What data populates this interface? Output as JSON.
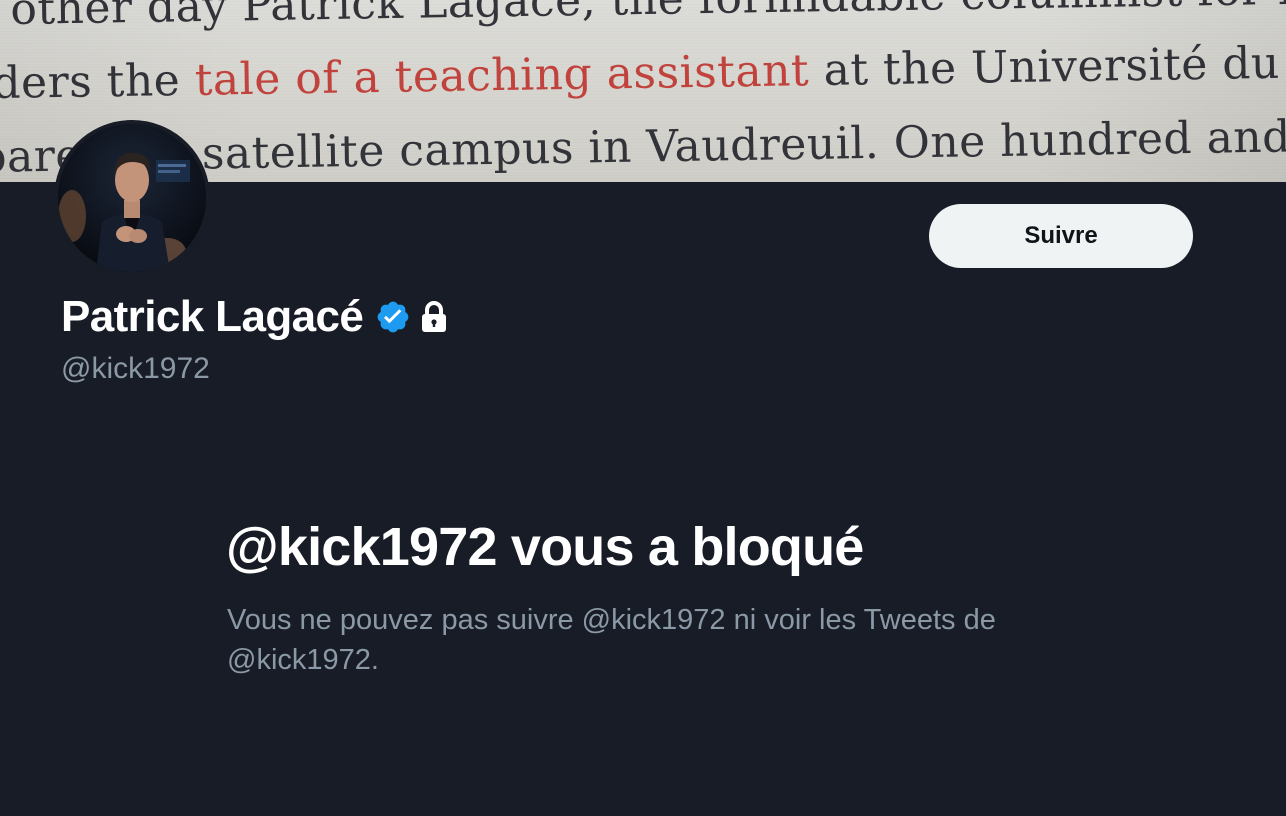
{
  "banner": {
    "line1": "other day Patrick Lagace, the formidable columnist for Mont",
    "line2_start": "ders the ",
    "line2_link": "tale of a teaching assistant",
    "line2_end": " at the Université du Québec",
    "line3": "pare  as a satellite campus in Vaudreuil. One hundred and s",
    "link_color": "#c2433d"
  },
  "profile": {
    "display_name": "Patrick Lagacé",
    "handle": "@kick1972",
    "verified_icon": "verified-badge-icon",
    "protected_icon": "lock-icon",
    "verified_color": "#1d9bf0"
  },
  "actions": {
    "follow_label": "Suivre"
  },
  "blocked": {
    "title": "@kick1972 vous a bloqué",
    "description": "Vous ne pouvez pas suivre @kick1972 ni voir les Tweets de @kick1972."
  },
  "colors": {
    "background": "#171c26",
    "primary_text": "#ffffff",
    "secondary_text": "#8b98a5",
    "button_bg": "#eff3f4"
  }
}
